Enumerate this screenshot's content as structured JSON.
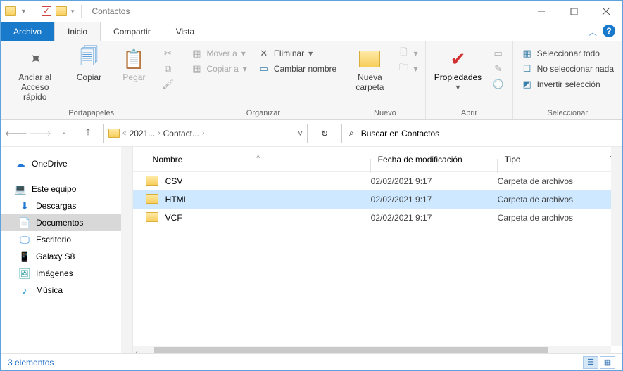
{
  "title": "Contactos",
  "tabs": {
    "file": "Archivo",
    "home": "Inicio",
    "share": "Compartir",
    "view": "Vista"
  },
  "ribbon": {
    "clipboard": {
      "pin": "Anclar al\nAcceso rápido",
      "copy": "Copiar",
      "paste": "Pegar",
      "group": "Portapapeles"
    },
    "organize": {
      "moveto": "Mover a",
      "copyto": "Copiar a",
      "delete": "Eliminar",
      "rename": "Cambiar nombre",
      "group": "Organizar"
    },
    "new": {
      "folder": "Nueva\ncarpeta",
      "group": "Nuevo"
    },
    "open": {
      "props": "Propiedades",
      "group": "Abrir"
    },
    "select": {
      "all": "Seleccionar todo",
      "none": "No seleccionar nada",
      "invert": "Invertir selección",
      "group": "Seleccionar"
    }
  },
  "breadcrumb": {
    "p1": "2021...",
    "p2": "Contact..."
  },
  "search": {
    "placeholder": "Buscar en Contactos"
  },
  "tree": [
    {
      "label": "OneDrive",
      "icon": "cloud",
      "cls": "first"
    },
    {
      "label": "Este equipo",
      "icon": "pc",
      "cls": "first",
      "gap": true
    },
    {
      "label": "Descargas",
      "icon": "dl"
    },
    {
      "label": "Documentos",
      "icon": "doc",
      "sel": true
    },
    {
      "label": "Escritorio",
      "icon": "desk"
    },
    {
      "label": "Galaxy S8",
      "icon": "phone"
    },
    {
      "label": "Imágenes",
      "icon": "img"
    },
    {
      "label": "Música",
      "icon": "mus"
    }
  ],
  "cols": {
    "name": "Nombre",
    "date": "Fecha de modificación",
    "type": "Tipo",
    "size": "T"
  },
  "rows": [
    {
      "name": "CSV",
      "date": "02/02/2021 9:17",
      "type": "Carpeta de archivos"
    },
    {
      "name": "HTML",
      "date": "02/02/2021 9:17",
      "type": "Carpeta de archivos",
      "sel": true
    },
    {
      "name": "VCF",
      "date": "02/02/2021 9:17",
      "type": "Carpeta de archivos"
    }
  ],
  "status": "3 elementos"
}
